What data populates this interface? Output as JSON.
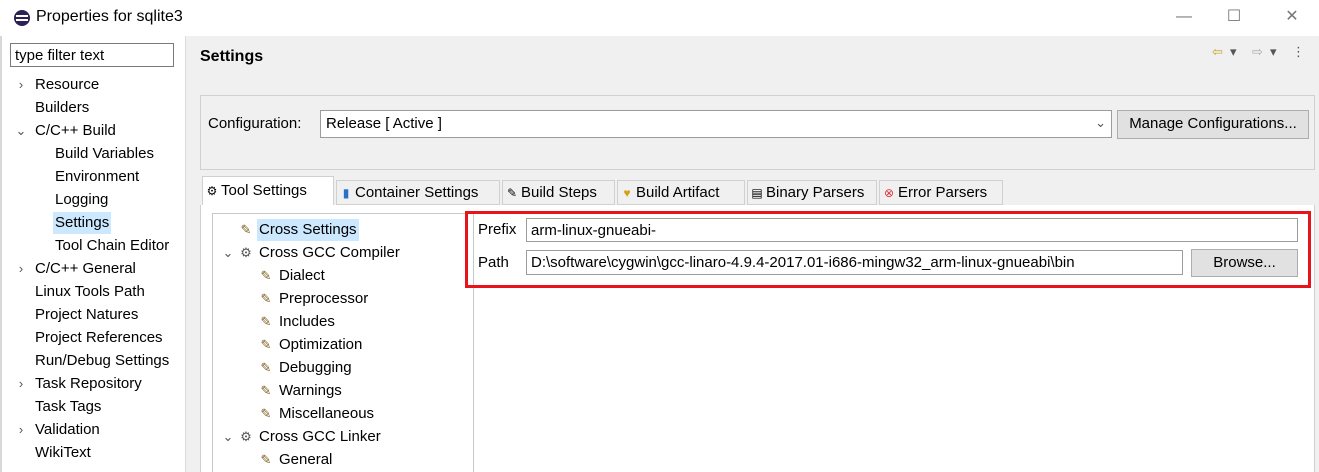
{
  "window": {
    "title": "Properties for sqlite3",
    "minimize_glyph": "—",
    "maximize_glyph": "☐",
    "close_glyph": "✕",
    "icon": "eclipse-icon"
  },
  "left_panel": {
    "filter_placeholder": "type filter text",
    "items": [
      {
        "label": "Resource",
        "expander": "›"
      },
      {
        "label": "Builders",
        "expander": ""
      },
      {
        "label": "C/C++ Build",
        "expander": "⌄"
      },
      {
        "label": "Build Variables",
        "expander": ""
      },
      {
        "label": "Environment",
        "expander": ""
      },
      {
        "label": "Logging",
        "expander": ""
      },
      {
        "label": "Settings",
        "expander": "",
        "selected": true
      },
      {
        "label": "Tool Chain Editor",
        "expander": ""
      },
      {
        "label": "C/C++ General",
        "expander": "›"
      },
      {
        "label": "Linux Tools Path",
        "expander": ""
      },
      {
        "label": "Project Natures",
        "expander": ""
      },
      {
        "label": "Project References",
        "expander": ""
      },
      {
        "label": "Run/Debug Settings",
        "expander": ""
      },
      {
        "label": "Task Repository",
        "expander": "›"
      },
      {
        "label": "Task Tags",
        "expander": ""
      },
      {
        "label": "Validation",
        "expander": "›"
      },
      {
        "label": "WikiText",
        "expander": ""
      }
    ]
  },
  "main": {
    "title": "Settings",
    "nav": {
      "back": "⇦",
      "back_menu": "▾",
      "forward": "⇨",
      "forward_menu": "▾",
      "more": "⋮"
    },
    "configuration": {
      "label": "Configuration:",
      "value": "Release  [ Active ]",
      "arrow": "⌄",
      "manage_button": "Manage Configurations..."
    },
    "tabs": [
      {
        "label": "Tool Settings",
        "icon": "⚙",
        "icon_name": "tool-settings-icon",
        "active": true
      },
      {
        "label": "Container Settings",
        "icon": "▮",
        "icon_name": "container-icon"
      },
      {
        "label": "Build Steps",
        "icon": "✎",
        "icon_name": "build-steps-icon"
      },
      {
        "label": "Build Artifact",
        "icon": "♥",
        "icon_name": "trophy-icon"
      },
      {
        "label": "Binary Parsers",
        "icon": "▤",
        "icon_name": "binary-parser-icon"
      },
      {
        "label": "Error Parsers",
        "icon": "⊗",
        "icon_name": "error-icon"
      }
    ],
    "tool_tree": [
      {
        "label": "Cross Settings",
        "icon": "✎",
        "expander": "",
        "selected": true
      },
      {
        "label": "Cross GCC Compiler",
        "icon": "⚙",
        "expander": "⌄"
      },
      {
        "label": "Dialect",
        "icon": "✎",
        "expander": ""
      },
      {
        "label": "Preprocessor",
        "icon": "✎",
        "expander": ""
      },
      {
        "label": "Includes",
        "icon": "✎",
        "expander": ""
      },
      {
        "label": "Optimization",
        "icon": "✎",
        "expander": ""
      },
      {
        "label": "Debugging",
        "icon": "✎",
        "expander": ""
      },
      {
        "label": "Warnings",
        "icon": "✎",
        "expander": ""
      },
      {
        "label": "Miscellaneous",
        "icon": "✎",
        "expander": ""
      },
      {
        "label": "Cross GCC Linker",
        "icon": "⚙",
        "expander": "⌄"
      },
      {
        "label": "General",
        "icon": "✎",
        "expander": ""
      }
    ],
    "form": {
      "prefix_label": "Prefix",
      "prefix_value": "arm-linux-gnueabi-",
      "path_label": "Path",
      "path_value": "D:\\software\\cygwin\\gcc-linaro-4.9.4-2017.01-i686-mingw32_arm-linux-gnueabi\\bin",
      "browse_button": "Browse..."
    },
    "highlight_color": "#e8141c"
  }
}
